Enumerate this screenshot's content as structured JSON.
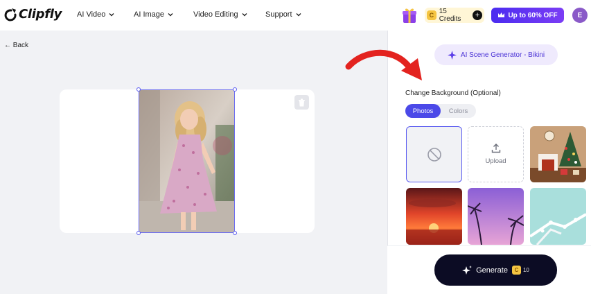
{
  "brand": {
    "name": "Clipfly"
  },
  "nav": {
    "items": [
      {
        "label": "AI Video"
      },
      {
        "label": "AI Image"
      },
      {
        "label": "Video Editing"
      },
      {
        "label": "Support"
      }
    ]
  },
  "header": {
    "credits_label": "15 Credits",
    "credits_coin": "C",
    "offer_label": "Up to 60% OFF",
    "avatar_initial": "E"
  },
  "back_label": "← Back",
  "panel": {
    "tool_label": "AI Scene Generator - Bikini",
    "section_title": "Change Background (Optional)",
    "tabs": [
      {
        "label": "Photos",
        "active": true
      },
      {
        "label": "Colors",
        "active": false
      }
    ],
    "upload_label": "Upload",
    "backgrounds": [
      "none",
      "upload",
      "christmas-room",
      "sunset-sea",
      "purple-palms",
      "frosted-branches"
    ]
  },
  "generate": {
    "label": "Generate",
    "coin": "C",
    "cost": "10"
  },
  "colors": {
    "accent": "#4b49e8",
    "offer": "#6a35f2",
    "generate_bg": "#0c0c24",
    "arrow": "#e3231f"
  }
}
